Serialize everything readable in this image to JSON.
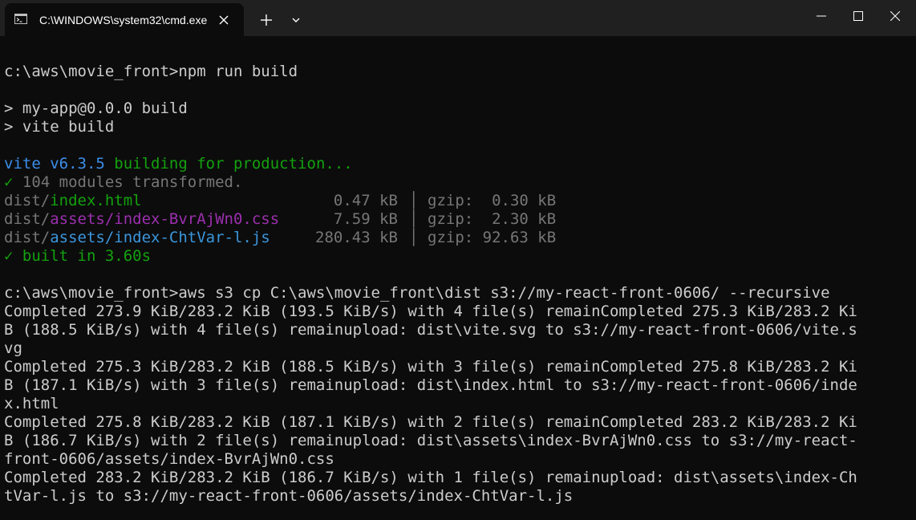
{
  "window": {
    "tab_title": "C:\\WINDOWS\\system32\\cmd.exe",
    "colors": {
      "titlebar": "#202020",
      "terminal_bg": "#0c0c0c",
      "text": "#cccccc",
      "vite_blue": "#3b8eea",
      "green": "#13a10e",
      "dim": "#767676",
      "cyan": "#3a96dd",
      "magenta": "#9b2fae"
    }
  },
  "terminal": {
    "cmd1": "c:\\aws\\movie_front>npm run build",
    "npm1": "> my-app@0.0.0 build",
    "npm2": "> vite build",
    "vite_name": "vite v6.3.5",
    "vite_building": " building for production...",
    "transformed_check": "✓",
    "transformed_text": " 104 modules transformed.",
    "files": [
      {
        "dir": "dist/",
        "name": "index.html",
        "size": "0.47 kB",
        "gzip": "gzip:  0.30 kB"
      },
      {
        "dir": "dist/",
        "name": "assets/index-BvrAjWn0.css",
        "size": "7.59 kB",
        "gzip": "gzip:  2.30 kB"
      },
      {
        "dir": "dist/",
        "name": "assets/index-ChtVar-l.js",
        "size": "280.43 kB",
        "gzip": "gzip: 92.63 kB"
      }
    ],
    "separator": "│",
    "built": "✓ built in 3.60s",
    "cmd2": "c:\\aws\\movie_front>aws s3 cp C:\\aws\\movie_front\\dist s3://my-react-front-0606/ --recursive",
    "output": [
      "Completed 273.9 KiB/283.2 KiB (193.5 KiB/s) with 4 file(s) remainCompleted 275.3 KiB/283.2 Ki",
      "B (188.5 KiB/s) with 4 file(s) remainupload: dist\\vite.svg to s3://my-react-front-0606/vite.s",
      "vg",
      "Completed 275.3 KiB/283.2 KiB (188.5 KiB/s) with 3 file(s) remainCompleted 275.8 KiB/283.2 Ki",
      "B (187.1 KiB/s) with 3 file(s) remainupload: dist\\index.html to s3://my-react-front-0606/inde",
      "x.html",
      "Completed 275.8 KiB/283.2 KiB (187.1 KiB/s) with 2 file(s) remainCompleted 283.2 KiB/283.2 Ki",
      "B (186.7 KiB/s) with 2 file(s) remainupload: dist\\assets\\index-BvrAjWn0.css to s3://my-react-",
      "front-0606/assets/index-BvrAjWn0.css",
      "Completed 283.2 KiB/283.2 KiB (186.7 KiB/s) with 1 file(s) remainupload: dist\\assets\\index-Ch",
      "tVar-l.js to s3://my-react-front-0606/assets/index-ChtVar-l.js"
    ]
  }
}
